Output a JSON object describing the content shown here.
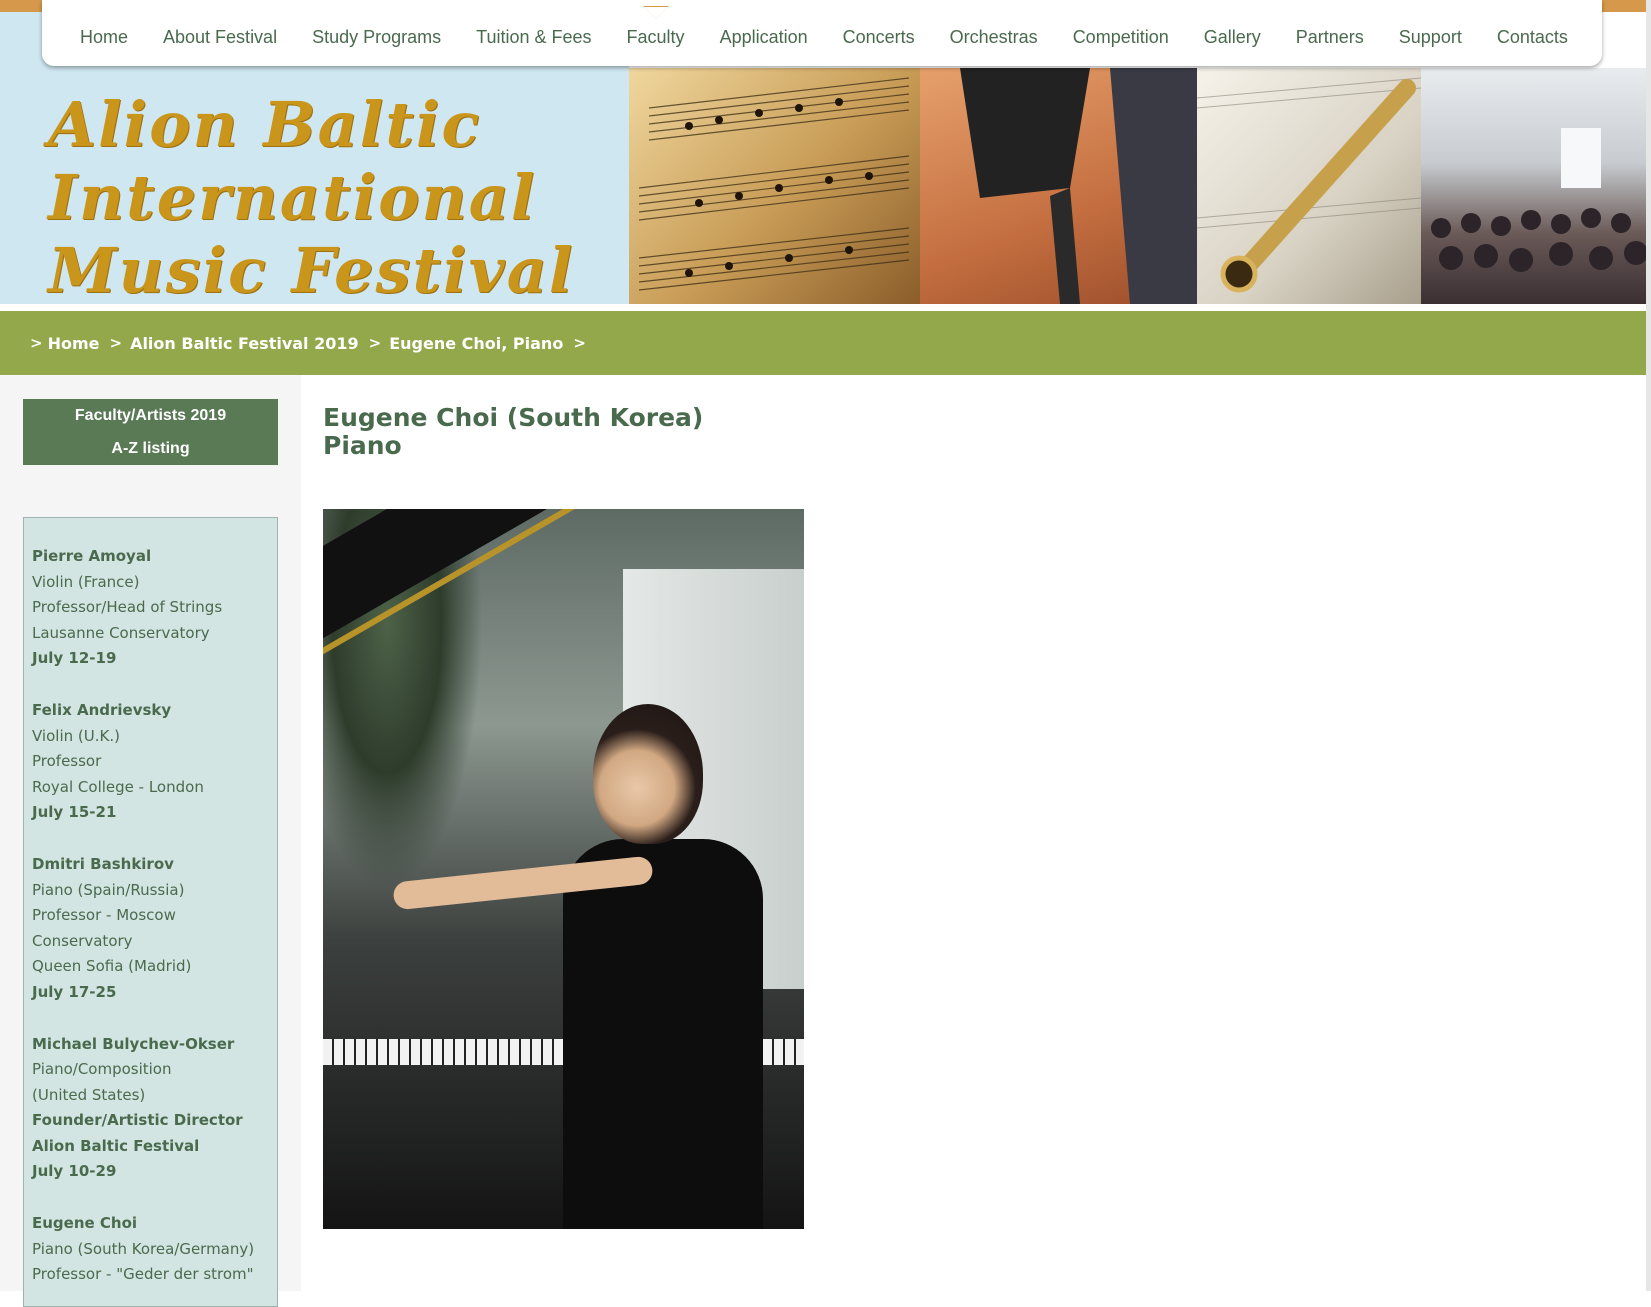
{
  "nav": {
    "items": [
      {
        "label": "Home"
      },
      {
        "label": "About Festival"
      },
      {
        "label": "Study Programs"
      },
      {
        "label": "Tuition & Fees"
      },
      {
        "label": "Faculty"
      },
      {
        "label": "Application"
      },
      {
        "label": "Concerts"
      },
      {
        "label": "Orchestras"
      },
      {
        "label": "Competition"
      },
      {
        "label": "Gallery"
      },
      {
        "label": "Partners"
      },
      {
        "label": "Support"
      },
      {
        "label": "Contacts"
      }
    ]
  },
  "banner": {
    "logo_lines": [
      "Alion Baltic",
      "International",
      "Music Festival"
    ]
  },
  "breadcrumb": {
    "items": [
      "Home",
      "Alion Baltic Festival 2019",
      "Eugene Choi, Piano"
    ]
  },
  "sidebar": {
    "heading_line1": "Faculty/Artists 2019",
    "heading_line2": "A-Z listing",
    "faculty": [
      {
        "lines": [
          {
            "text": "Pierre Amoyal",
            "bold": true
          },
          {
            "text": "Violin (France)",
            "bold": false
          },
          {
            "text": "Professor/Head of Strings",
            "bold": false
          },
          {
            "text": "Lausanne Conservatory",
            "bold": false
          },
          {
            "text": "July 12-19",
            "bold": true
          }
        ]
      },
      {
        "lines": [
          {
            "text": "Felix Andrievsky",
            "bold": true
          },
          {
            "text": "Violin (U.K.)",
            "bold": false
          },
          {
            "text": "Professor",
            "bold": false
          },
          {
            "text": "Royal College - London",
            "bold": false
          },
          {
            "text": "July 15-21",
            "bold": true
          }
        ]
      },
      {
        "lines": [
          {
            "text": "Dmitri Bashkirov",
            "bold": true
          },
          {
            "text": "Piano (Spain/Russia)",
            "bold": false
          },
          {
            "text": "Professor - Moscow",
            "bold": false
          },
          {
            "text": "Conservatory",
            "bold": false
          },
          {
            "text": "Queen Sofia (Madrid)",
            "bold": false
          },
          {
            "text": "July 17-25",
            "bold": true
          }
        ]
      },
      {
        "lines": [
          {
            "text": "Michael Bulychev-Okser",
            "bold": true
          },
          {
            "text": "Piano/Composition",
            "bold": false
          },
          {
            "text": "(United States)",
            "bold": false
          },
          {
            "text": "Founder/Artistic Director",
            "bold": true
          },
          {
            "text": "Alion Baltic Festival",
            "bold": true
          },
          {
            "text": "July 10-29",
            "bold": true
          }
        ]
      },
      {
        "lines": [
          {
            "text": "Eugene Choi",
            "bold": true
          },
          {
            "text": "Piano (South Korea/Germany)",
            "bold": false
          },
          {
            "text": "Professor - \"Geder der strom\"",
            "bold": false
          }
        ]
      }
    ]
  },
  "main": {
    "title_line1": "Eugene Choi (South Korea)",
    "title_line2": "Piano"
  }
}
